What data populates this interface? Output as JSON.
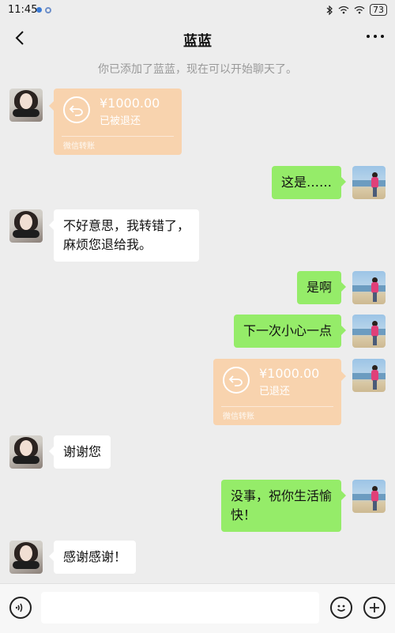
{
  "status_bar": {
    "time": "11:45",
    "battery": "73"
  },
  "header": {
    "title": "蓝蓝"
  },
  "system_message": "你已添加了蓝蓝，现在可以开始聊天了。",
  "messages": [
    {
      "side": "left",
      "type": "transfer",
      "amount": "¥1000.00",
      "status": "已被退还",
      "footer": "微信转账"
    },
    {
      "side": "right",
      "type": "text",
      "text": "这是……"
    },
    {
      "side": "left",
      "type": "text",
      "line1": "不好意思，我转错了，",
      "line2": "麻烦您退给我。"
    },
    {
      "side": "right",
      "type": "text",
      "text": "是啊"
    },
    {
      "side": "right",
      "type": "text",
      "text": "下一次小心一点"
    },
    {
      "side": "right",
      "type": "transfer",
      "amount": "¥1000.00",
      "status": "已退还",
      "footer": "微信转账"
    },
    {
      "side": "left",
      "type": "text",
      "text": "谢谢您"
    },
    {
      "side": "right",
      "type": "text",
      "line1": "没事，祝你生活愉",
      "line2": "快！"
    },
    {
      "side": "left",
      "type": "text",
      "text": "感谢感谢！"
    }
  ],
  "input": {
    "value": "",
    "placeholder": ""
  },
  "colors": {
    "sent_bubble": "#95ec69",
    "received_bubble": "#ffffff",
    "transfer_card": "#f8d3ae",
    "background": "#ededed"
  }
}
